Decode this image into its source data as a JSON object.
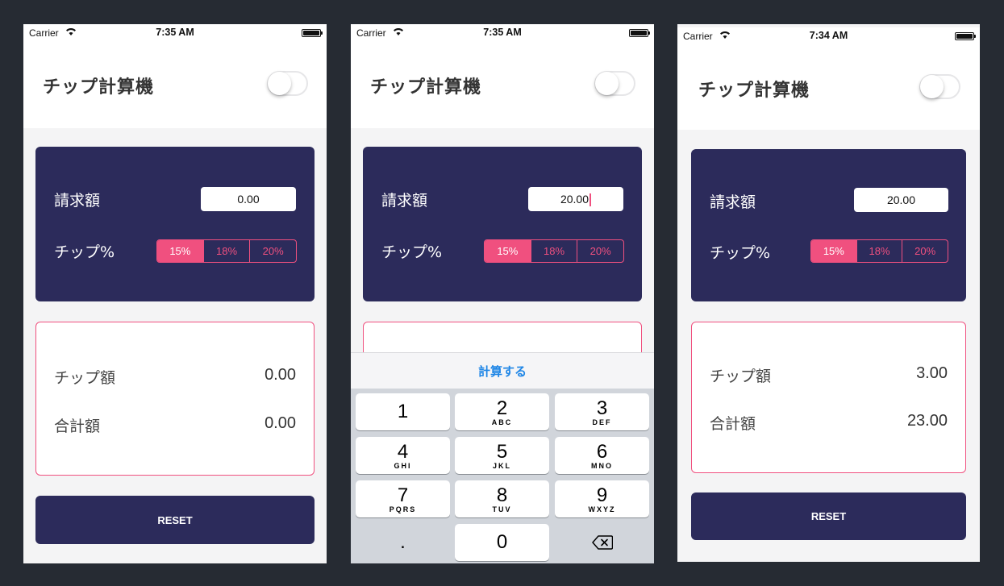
{
  "screens": [
    {
      "status": {
        "carrier": "Carrier",
        "time": "7:35 AM"
      },
      "title": "チップ計算機",
      "bill_label": "請求額",
      "bill_value": "0.00",
      "tip_label": "チップ%",
      "tip_options": [
        "15%",
        "18%",
        "20%"
      ],
      "tip_amount_label": "チップ額",
      "tip_amount": "0.00",
      "total_label": "合計額",
      "total": "0.00",
      "reset_label": "RESET"
    },
    {
      "status": {
        "carrier": "Carrier",
        "time": "7:35 AM"
      },
      "title": "チップ計算機",
      "bill_label": "請求額",
      "bill_value": "20.00",
      "tip_label": "チップ%",
      "tip_options": [
        "15%",
        "18%",
        "20%"
      ],
      "accessory_button": "計算する",
      "keys": [
        {
          "num": "1",
          "letters": ""
        },
        {
          "num": "2",
          "letters": "ABC"
        },
        {
          "num": "3",
          "letters": "DEF"
        },
        {
          "num": "4",
          "letters": "GHI"
        },
        {
          "num": "5",
          "letters": "JKL"
        },
        {
          "num": "6",
          "letters": "MNO"
        },
        {
          "num": "7",
          "letters": "PQRS"
        },
        {
          "num": "8",
          "letters": "TUV"
        },
        {
          "num": "9",
          "letters": "WXYZ"
        },
        {
          "num": ".",
          "letters": ""
        },
        {
          "num": "0",
          "letters": ""
        }
      ]
    },
    {
      "status": {
        "carrier": "Carrier",
        "time": "7:34 AM"
      },
      "title": "チップ計算機",
      "bill_label": "請求額",
      "bill_value": "20.00",
      "tip_label": "チップ%",
      "tip_options": [
        "15%",
        "18%",
        "20%"
      ],
      "tip_amount_label": "チップ額",
      "tip_amount": "3.00",
      "total_label": "合計額",
      "total": "23.00",
      "reset_label": "RESET"
    }
  ],
  "colors": {
    "navy": "#2c2b5b",
    "accent_pink": "#f0507f",
    "link_blue": "#1f86e6",
    "page_bg": "#262b33"
  },
  "selected_tip_index": 0,
  "dark_mode_toggle": false
}
